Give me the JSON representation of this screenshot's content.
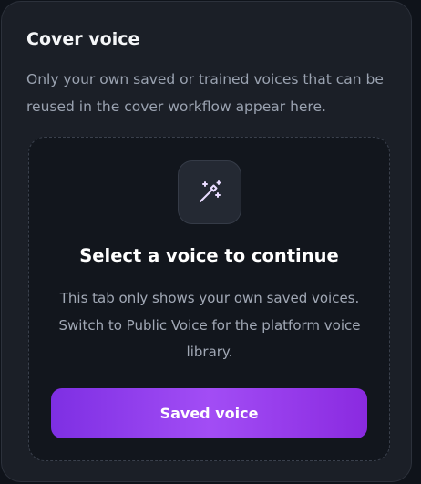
{
  "panel": {
    "title": "Cover voice",
    "description": "Only your own saved or trained voices that can be reused in the cover workflow appear here."
  },
  "empty_state": {
    "icon": "magic-wand-icon",
    "title": "Select a voice to continue",
    "description": "This tab only shows your own saved voices. Switch to Public Voice for the platform voice library.",
    "button_label": "Saved voice"
  },
  "colors": {
    "background": "#0f131a",
    "card": "#1b1f27",
    "accent_start": "#7e2fe3",
    "accent_mid": "#a24df5",
    "icon_stroke": "#e9dcff"
  }
}
